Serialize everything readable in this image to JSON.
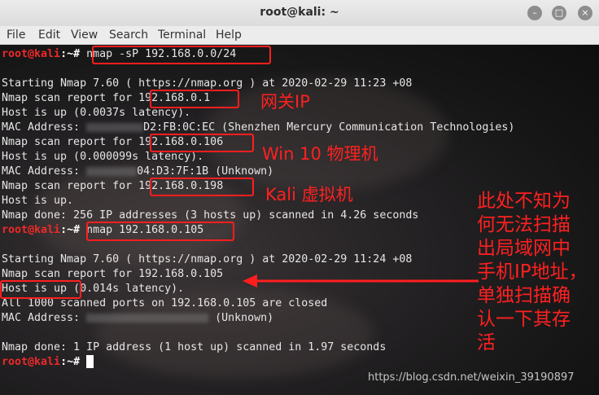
{
  "window": {
    "title": "root@kali: ~",
    "buttons": {
      "minimize": "–",
      "maximize": "□",
      "close": "×"
    }
  },
  "menu": [
    "File",
    "Edit",
    "View",
    "Search",
    "Terminal",
    "Help"
  ],
  "prompt": {
    "user": "root@kali",
    "rest": ":~#"
  },
  "terminal": {
    "cmd1": "nmap -sP 192.168.0.0/24",
    "l_start1": "Starting Nmap 7.60 ( https://nmap.org ) at 2020-02-29 11:23 +08",
    "report_prefix": "Nmap scan report for ",
    "ip1": "192.168.0.1",
    "up1": "Host is up (0.0037s latency).",
    "mac_prefix": "MAC Address: ",
    "mac1_rest": "D2:FB:0C:EC (Shenzhen Mercury Communication Technologies)",
    "ip2": "192.168.0.106",
    "up2": "Host is up (0.000099s latency).",
    "mac2_rest": "04:D3:7F:1B (Unknown)",
    "ip3": "192.168.0.198",
    "up3": "Host is up.",
    "done1": "Nmap done: 256 IP addresses (3 hosts up) scanned in 4.26 seconds",
    "cmd2": "nmap 192.168.0.105",
    "l_start2": "Starting Nmap 7.60 ( https://nmap.org ) at 2020-02-29 11:24 +08",
    "report2": "Nmap scan report for 192.168.0.105",
    "hostup": "Host is up",
    "hostup_rest": " (0.014s latency).",
    "closed": "All 1000 scanned ports on 192.168.0.105 are closed",
    "mac3_rest": "(Unknown)",
    "done2": "Nmap done: 1 IP address (1 host up) scanned in 1.97 seconds"
  },
  "annotations": {
    "gateway": "网关IP",
    "win10": "Win 10 物理机",
    "kali_vm": "Kali 虚拟机",
    "side_note": "此处不知为何无法扫描出局域网中手机IP地址，单独扫描确认一下其存活"
  },
  "colors": {
    "prompt_user": "#ef2929",
    "annotation": "#ff1e1e"
  },
  "watermark": "https://blog.csdn.net/weixin_39190897"
}
